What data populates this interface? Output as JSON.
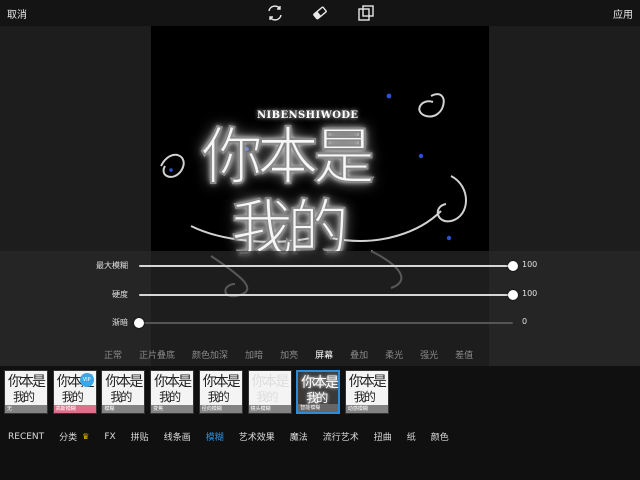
{
  "topbar": {
    "cancel": "取消",
    "apply": "应用",
    "icons": [
      "swap-icon",
      "eraser-icon",
      "layers-icon"
    ]
  },
  "artwork": {
    "caption": "NIBENSHIWODE",
    "line1": "你本是",
    "line2": "我的"
  },
  "sliders": [
    {
      "label": "最大模糊",
      "value": "100",
      "fraction": 1.0
    },
    {
      "label": "硬度",
      "value": "100",
      "fraction": 1.0
    },
    {
      "label": "渐暗",
      "value": "0",
      "fraction": 0.0
    }
  ],
  "blend_modes": {
    "items": [
      "正常",
      "正片叠底",
      "颜色加深",
      "加暗",
      "加亮",
      "屏幕",
      "叠加",
      "柔光",
      "强光",
      "差值"
    ],
    "active_index": 5
  },
  "thumbnails": [
    {
      "caption": "无",
      "style": "normal"
    },
    {
      "caption": "高斯模糊",
      "style": "pink",
      "badge": "VIP"
    },
    {
      "caption": "模糊",
      "style": "normal"
    },
    {
      "caption": "变焦",
      "style": "normal"
    },
    {
      "caption": "径向模糊",
      "style": "normal"
    },
    {
      "caption": "镜头模糊",
      "style": "faint"
    },
    {
      "caption": "智能模糊",
      "style": "selected"
    },
    {
      "caption": "动感模糊",
      "style": "normal"
    }
  ],
  "categories": {
    "items": [
      "RECENT",
      "分类",
      "FX",
      "拼贴",
      "线条画",
      "模糊",
      "艺术效果",
      "魔法",
      "流行艺术",
      "扭曲",
      "纸",
      "颜色"
    ],
    "active_index": 5,
    "crown_after_index": 1
  },
  "colors": {
    "accent": "#2b8bd6",
    "vip_badge": "#3aa7e8",
    "premium_caption": "#e0708a",
    "crown": "#f2b400"
  }
}
